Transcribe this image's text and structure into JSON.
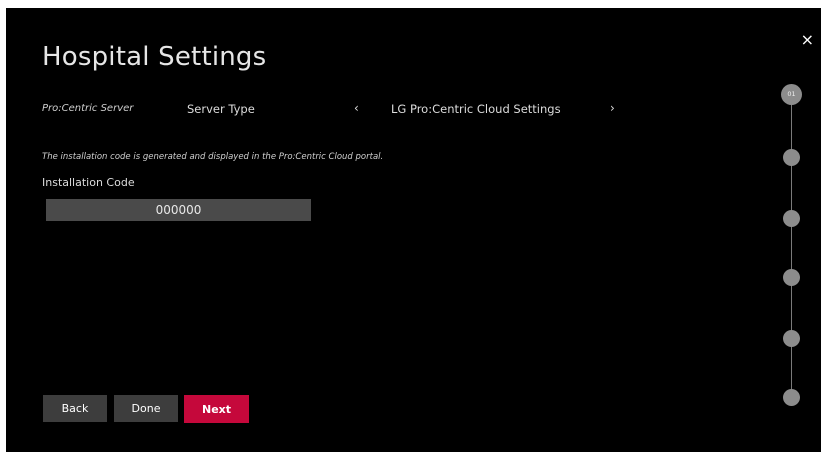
{
  "header": {
    "title": "Hospital Settings",
    "close_label": "×"
  },
  "settings_row": {
    "section_label": "Pro:Centric Server",
    "field_label": "Server Type",
    "prev_arrow": "‹",
    "selected_value": "LG Pro:Centric Cloud Settings",
    "next_arrow": "›"
  },
  "description": "The installation code is generated and displayed in the Pro:Centric Cloud portal.",
  "installation_code": {
    "label": "Installation Code",
    "value": "000000"
  },
  "buttons": {
    "back": "Back",
    "done": "Done",
    "next": "Next"
  },
  "stepper": {
    "current_step": "01",
    "total_steps": 6,
    "active_color": "#8c8c8c"
  },
  "colors": {
    "background": "#000000",
    "accent": "#c5083b",
    "button_bg": "#3d3d3d",
    "input_bg": "#4a4a4a"
  }
}
